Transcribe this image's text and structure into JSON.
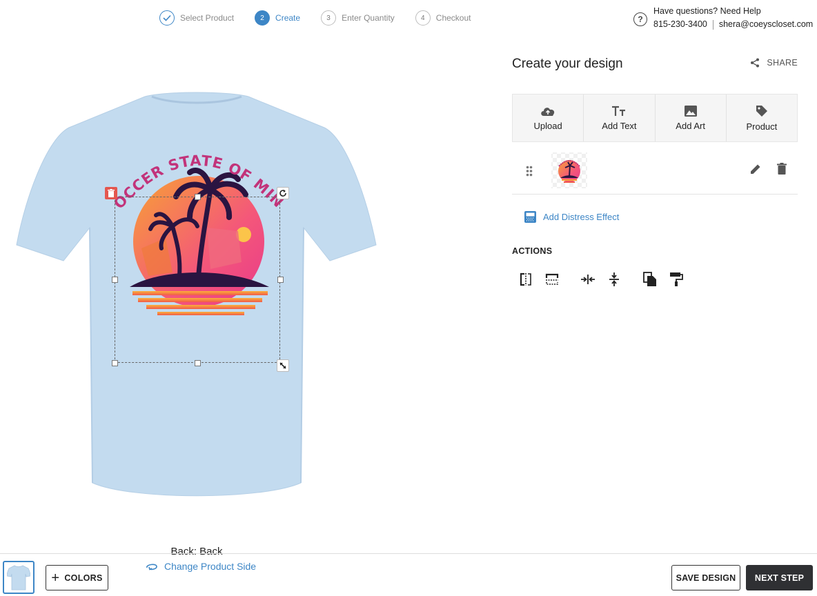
{
  "stepper": [
    {
      "num": "",
      "label": "Select Product",
      "state": "done"
    },
    {
      "num": "2",
      "label": "Create",
      "state": "active"
    },
    {
      "num": "3",
      "label": "Enter Quantity",
      "state": "pending"
    },
    {
      "num": "4",
      "label": "Checkout",
      "state": "pending"
    }
  ],
  "help": {
    "question": "Have questions? Need Help",
    "phone": "815-230-3400",
    "email": "shera@coeyscloset.com"
  },
  "design": {
    "artwork_text": "SOCCER STATE OF MIND",
    "side_label": "Back: Back",
    "change_side": "Change Product Side"
  },
  "panel": {
    "title": "Create your design",
    "share": "SHARE",
    "tools": [
      {
        "label": "Upload",
        "icon": "cloud-upload-icon"
      },
      {
        "label": "Add Text",
        "icon": "text-icon"
      },
      {
        "label": "Add Art",
        "icon": "image-icon"
      },
      {
        "label": "Product",
        "icon": "tag-icon"
      }
    ],
    "distress": "Add Distress Effect",
    "actions_title": "ACTIONS"
  },
  "footer": {
    "colors": "COLORS",
    "save": "SAVE DESIGN",
    "next": "NEXT STEP"
  },
  "colors": {
    "accent": "#3d86c6",
    "shirt": "#c3dbef",
    "delete_red": "#e4574f",
    "next_bg": "#2f3033"
  }
}
